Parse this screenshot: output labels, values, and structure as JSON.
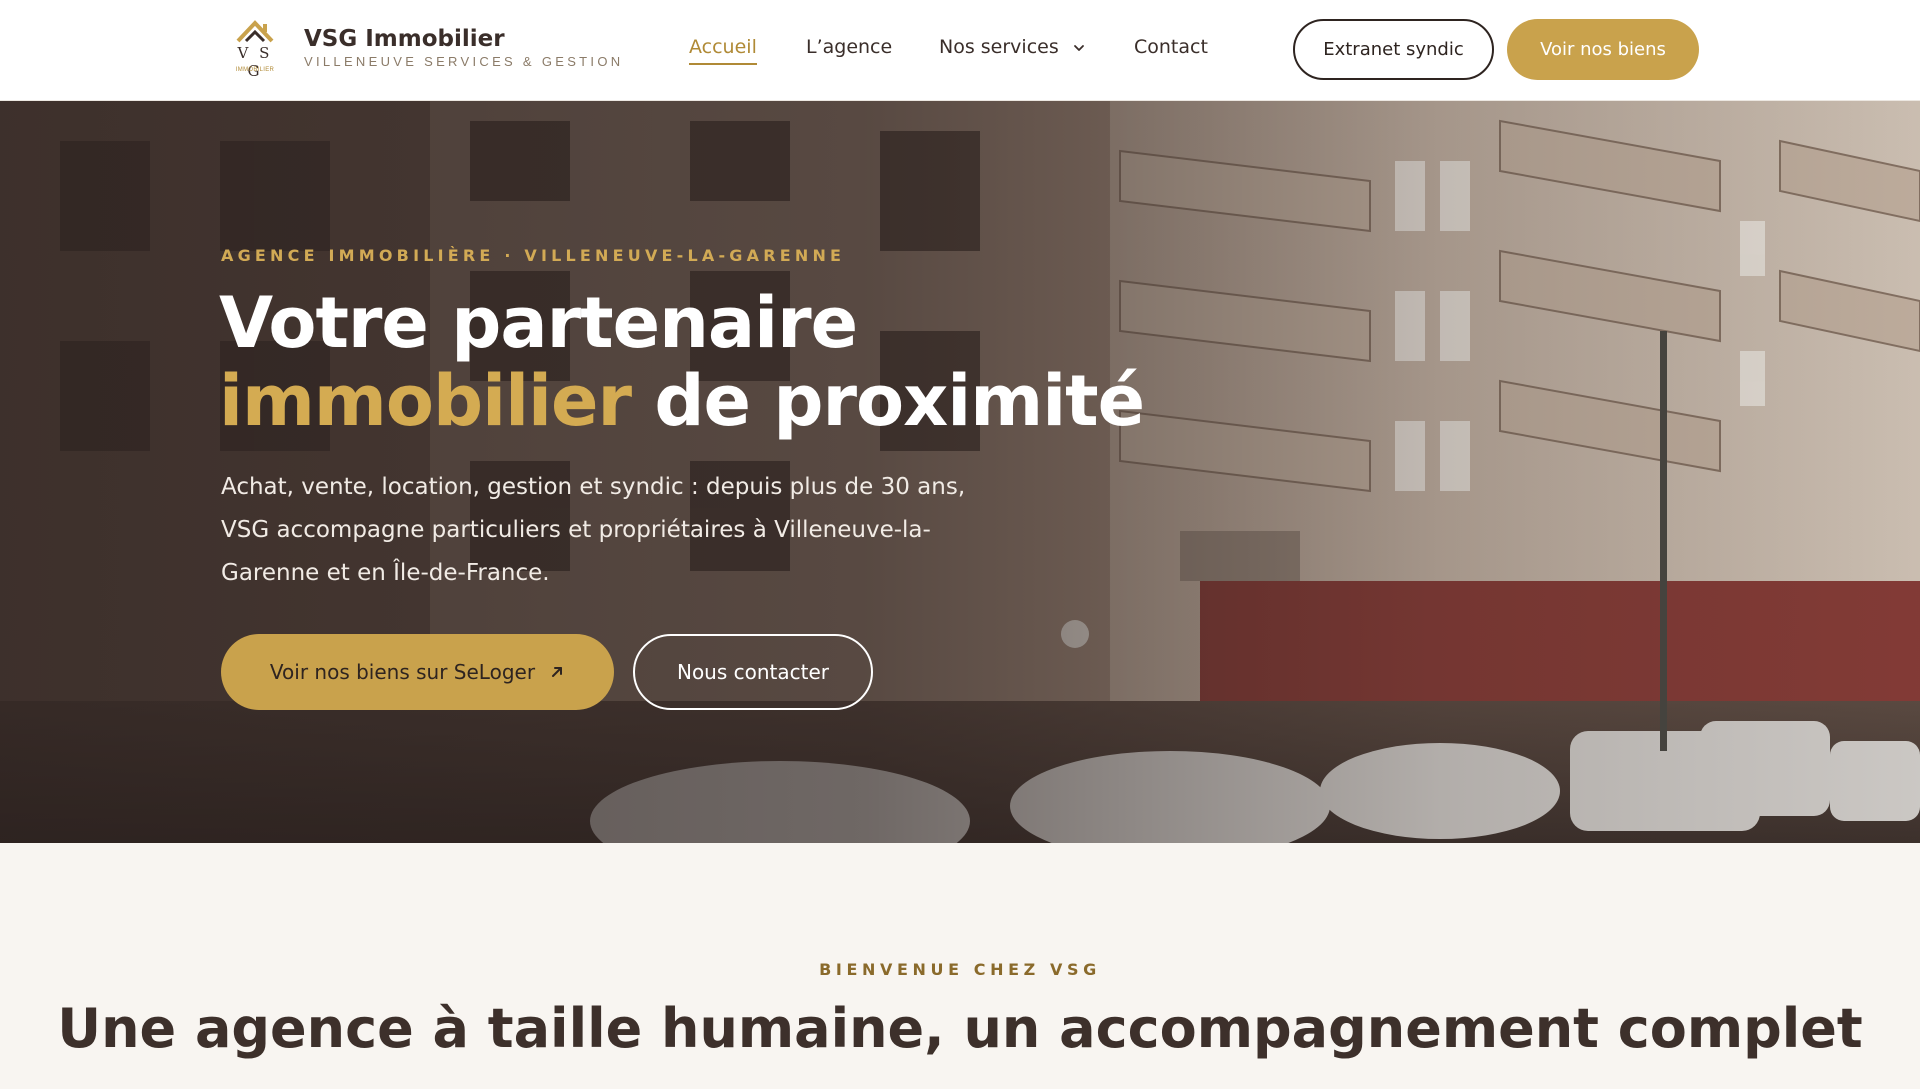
{
  "brand": {
    "logo_letters": "V S G",
    "logo_sub": "IMMOBILIER",
    "name": "VSG Immobilier",
    "tagline": "VILLENEUVE SERVICES & GESTION"
  },
  "nav": {
    "items": [
      {
        "label": "Accueil",
        "active": true
      },
      {
        "label": "L’agence",
        "active": false
      },
      {
        "label": "Nos services",
        "active": false,
        "has_dropdown": true
      },
      {
        "label": "Contact",
        "active": false
      }
    ]
  },
  "header_actions": {
    "extranet_label": "Extranet syndic",
    "listings_label": "Voir nos biens"
  },
  "hero": {
    "eyebrow": "AGENCE IMMOBILIÈRE · VILLENEUVE-LA-GARENNE",
    "title_line1": "Votre partenaire",
    "title_accent": "immobilier",
    "title_line2_rest": " de proximité",
    "description": "Achat, vente, location, gestion et syndic : depuis plus de 30 ans, VSG accompagne particuliers et propriétaires à Villeneuve-la-Garenne et en Île-de-France.",
    "primary_button": "Voir nos biens sur SeLoger",
    "secondary_button": "Nous contacter"
  },
  "welcome": {
    "eyebrow": "BIENVENUE CHEZ VSG",
    "title": "Une agence à taille humaine, un accompagnement complet"
  },
  "colors": {
    "gold": "#c9a24c",
    "gold_text": "#b08a36",
    "dark": "#2e2420",
    "background": "#f8f5f1"
  },
  "icons": [
    "logo-roof-icon",
    "chevron-down-icon",
    "external-arrow-icon"
  ]
}
